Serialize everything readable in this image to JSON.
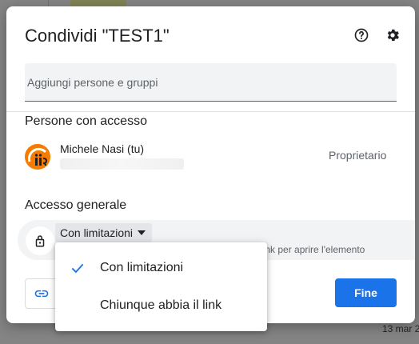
{
  "dialog": {
    "title": "Condividi \"TEST1\"",
    "add_people_placeholder": "Aggiungi persone e gruppi",
    "people_section_label": "Persone con accesso",
    "general_access_label": "Accesso generale",
    "done_label": "Fine"
  },
  "people": [
    {
      "name": "Michele Nasi (tu)",
      "role": "Proprietario"
    }
  ],
  "general_access": {
    "selected": "Con limitazioni",
    "description": "link per aprire l'elemento"
  },
  "access_menu": {
    "options": [
      {
        "label": "Con limitazioni",
        "checked": true
      },
      {
        "label": "Chiunque abbia il link",
        "checked": false
      }
    ]
  },
  "background": {
    "date_text": "13 mar 2"
  },
  "colors": {
    "primary": "#1a73e8",
    "surface": "#f1f3f4",
    "text": "#202124",
    "muted": "#5f6368"
  },
  "icons": {
    "help": "help-circle-icon",
    "settings": "gear-icon",
    "lock": "lock-icon",
    "dropdown": "caret-down-icon",
    "check": "check-icon",
    "link": "link-icon"
  }
}
